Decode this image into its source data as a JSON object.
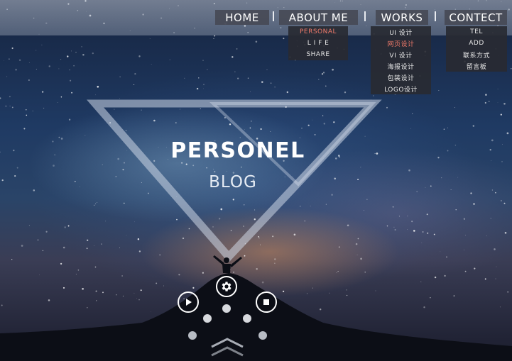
{
  "nav": {
    "home": "HOME",
    "about": "ABOUT ME",
    "works": "WORKS",
    "contact": "CONTECT"
  },
  "about_menu": [
    "PERSONAL",
    "L I F E",
    "SHARE"
  ],
  "works_menu": [
    "UI 设计",
    "网页设计",
    "VI 设计",
    "海报设计",
    "包装设计",
    "LOGO设计"
  ],
  "contact_menu": [
    "TEL",
    "ADD",
    "联系方式",
    "留言板"
  ],
  "hero": {
    "title": "PERSONEL",
    "subtitle": "BLOG"
  },
  "controls": {
    "settings_icon": "gear-icon",
    "play_icon": "play-icon",
    "stop_icon": "stop-icon",
    "scroll_icon": "chevron-up-icon"
  },
  "colors": {
    "nav_bg": "#464a56",
    "submenu_bg": "#282a32",
    "active_item": "#f07a6a"
  }
}
